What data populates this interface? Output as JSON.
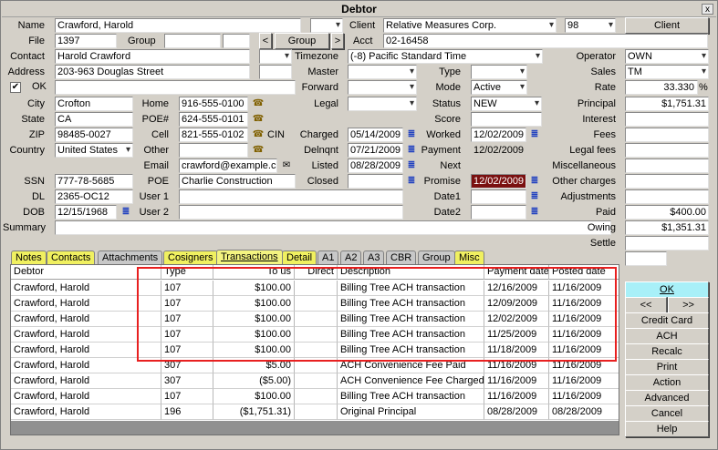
{
  "window": {
    "title": "Debtor",
    "close_glyph": "x"
  },
  "labels": {
    "name": "Name",
    "file": "File",
    "group": "Group",
    "contact": "Contact",
    "address": "Address",
    "ok": "OK",
    "city": "City",
    "state": "State",
    "zip": "ZIP",
    "country": "Country",
    "ssn": "SSN",
    "dl": "DL",
    "dob": "DOB",
    "summary": "Summary",
    "home": "Home",
    "poe_num": "POE#",
    "cell": "Cell",
    "other": "Other",
    "email": "Email",
    "poe": "POE",
    "user1": "User 1",
    "user2": "User 2",
    "client": "Client",
    "acct": "Acct",
    "timezone": "Timezone",
    "master": "Master",
    "forward": "Forward",
    "legal": "Legal",
    "charged": "Charged",
    "delnqnt": "Delnqnt",
    "listed": "Listed",
    "closed": "Closed",
    "type": "Type",
    "mode": "Mode",
    "status": "Status",
    "score": "Score",
    "worked": "Worked",
    "payment": "Payment",
    "next": "Next",
    "promise": "Promise",
    "date1": "Date1",
    "date2": "Date2",
    "operator": "Operator",
    "sales": "Sales",
    "rate": "Rate",
    "principal": "Principal",
    "interest": "Interest",
    "fees": "Fees",
    "legal_fees": "Legal fees",
    "miscellaneous": "Miscellaneous",
    "other_charges": "Other charges",
    "adjustments": "Adjustments",
    "paid": "Paid",
    "owing": "Owing",
    "settle": "Settle"
  },
  "values": {
    "name": "Crawford, Harold",
    "file": "1397",
    "contact": "Harold Crawford",
    "address": "203-963 Douglas Street",
    "city": "Crofton",
    "state": "CA",
    "zip": "98485-0027",
    "country": "United States",
    "ssn": "777-78-5685",
    "dl": "2365-OC12",
    "dob": "12/15/1968",
    "home": "916-555-0100",
    "poe_num": "624-555-0101",
    "cell": "821-555-0102",
    "cell_carrier": "CIN",
    "email": "crawford@example.ca",
    "poe": "Charlie Construction",
    "client": "Relative Measures Corp.",
    "client_code": "98",
    "acct": "02-16458",
    "timezone": "(-8) Pacific Standard Time",
    "charged": "05/14/2009",
    "delnqnt": "07/21/2009",
    "listed": "08/28/2009",
    "mode": "Active",
    "status": "NEW",
    "worked": "12/02/2009",
    "payment": "12/02/2009",
    "promise": "12/02/2009",
    "operator": "OWN",
    "sales": "TM",
    "rate": "33.330",
    "rate_unit": "%",
    "principal": "$1,751.31",
    "paid": "$400.00",
    "owing": "$1,351.31"
  },
  "buttons": {
    "client": "Client",
    "group": "Group",
    "group_prev": "<",
    "group_next": ">",
    "ok": "OK",
    "prev": "<<",
    "next": ">>",
    "credit_card": "Credit Card",
    "ach": "ACH",
    "recalc": "Recalc",
    "print": "Print",
    "action": "Action",
    "advanced": "Advanced",
    "cancel": "Cancel",
    "help": "Help"
  },
  "tabs": [
    "Notes",
    "Contacts",
    "Attachments",
    "Cosigners",
    "Transactions",
    "Detail",
    "A1",
    "A2",
    "A3",
    "CBR",
    "Group",
    "Misc"
  ],
  "table": {
    "headers": [
      "Debtor",
      "Type",
      "To us",
      "Direct",
      "Description",
      "Payment date",
      "Posted date"
    ],
    "rows": [
      [
        "Crawford, Harold",
        "107",
        "$100.00",
        "",
        "Billing Tree ACH transaction",
        "12/16/2009",
        "11/16/2009"
      ],
      [
        "Crawford, Harold",
        "107",
        "$100.00",
        "",
        "Billing Tree ACH transaction",
        "12/09/2009",
        "11/16/2009"
      ],
      [
        "Crawford, Harold",
        "107",
        "$100.00",
        "",
        "Billing Tree ACH transaction",
        "12/02/2009",
        "11/16/2009"
      ],
      [
        "Crawford, Harold",
        "107",
        "$100.00",
        "",
        "Billing Tree ACH transaction",
        "11/25/2009",
        "11/16/2009"
      ],
      [
        "Crawford, Harold",
        "107",
        "$100.00",
        "",
        "Billing Tree ACH transaction",
        "11/18/2009",
        "11/16/2009"
      ],
      [
        "Crawford, Harold",
        "307",
        "$5.00",
        "",
        "ACH Convenience Fee Paid",
        "11/16/2009",
        "11/16/2009"
      ],
      [
        "Crawford, Harold",
        "307",
        "($5.00)",
        "",
        "ACH Convenience Fee Charged",
        "11/16/2009",
        "11/16/2009"
      ],
      [
        "Crawford, Harold",
        "107",
        "$100.00",
        "",
        "Billing Tree ACH transaction",
        "11/16/2009",
        "11/16/2009"
      ],
      [
        "Crawford, Harold",
        "196",
        "($1,751.31)",
        "",
        "Original Principal",
        "08/28/2009",
        "08/28/2009"
      ]
    ]
  },
  "colors": {
    "highlight_box": "#e82020",
    "promise_bg": "#7a1010",
    "ok_button": "#a8f0f8",
    "tab_yellow": "#f0f060"
  }
}
